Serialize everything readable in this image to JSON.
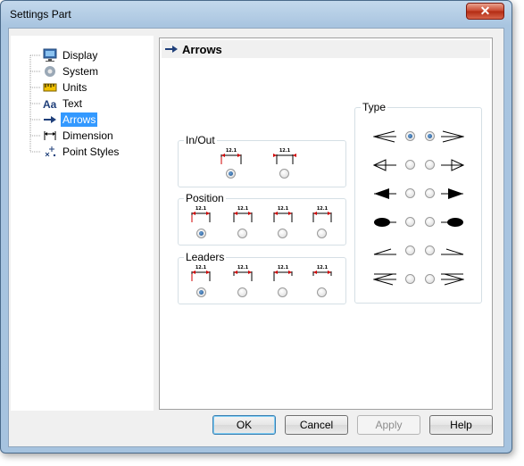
{
  "window": {
    "title": "Settings Part",
    "close_label": "✕"
  },
  "tree": {
    "items": [
      {
        "label": "Display",
        "icon": "display-icon"
      },
      {
        "label": "System",
        "icon": "system-icon"
      },
      {
        "label": "Units",
        "icon": "units-icon"
      },
      {
        "label": "Text",
        "icon": "text-icon"
      },
      {
        "label": "Arrows",
        "icon": "arrows-icon",
        "selected": true
      },
      {
        "label": "Dimension",
        "icon": "dimension-icon"
      },
      {
        "label": "Point Styles",
        "icon": "point-styles-icon"
      }
    ]
  },
  "panel": {
    "title": "Arrows",
    "groups": {
      "inout": {
        "label": "In/Out",
        "selected_index": 0
      },
      "position": {
        "label": "Position",
        "selected_index": 0
      },
      "leaders": {
        "label": "Leaders",
        "selected_index": 0
      },
      "type": {
        "label": "Type",
        "rows": [
          "open-arrow",
          "closed-outline-arrow",
          "filled-arrow",
          "ellipse-dot",
          "slash-tick",
          "double-line-arrow"
        ],
        "selected_left": 0,
        "selected_right": 0
      }
    },
    "dim_value": "12.1"
  },
  "buttons": {
    "ok": "OK",
    "cancel": "Cancel",
    "apply": "Apply",
    "help": "Help"
  },
  "colors": {
    "selection": "#3399ff",
    "arrow_red": "#d00000"
  }
}
